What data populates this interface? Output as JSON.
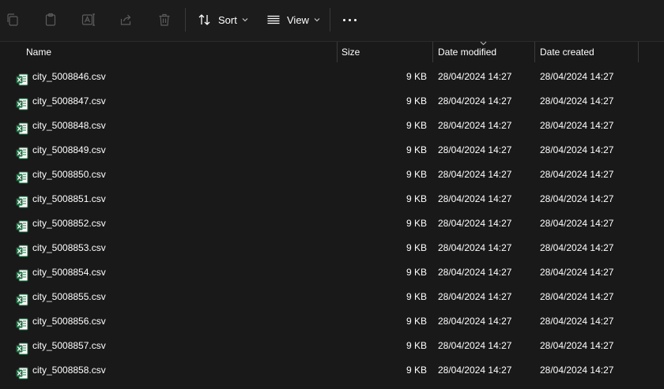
{
  "toolbar": {
    "sort_label": "Sort",
    "view_label": "View"
  },
  "columns": {
    "name": "Name",
    "size": "Size",
    "date_modified": "Date modified",
    "date_created": "Date created"
  },
  "files": [
    {
      "name": "city_5008846.csv",
      "size": "9 KB",
      "modified": "28/04/2024 14:27",
      "created": "28/04/2024 14:27"
    },
    {
      "name": "city_5008847.csv",
      "size": "9 KB",
      "modified": "28/04/2024 14:27",
      "created": "28/04/2024 14:27"
    },
    {
      "name": "city_5008848.csv",
      "size": "9 KB",
      "modified": "28/04/2024 14:27",
      "created": "28/04/2024 14:27"
    },
    {
      "name": "city_5008849.csv",
      "size": "9 KB",
      "modified": "28/04/2024 14:27",
      "created": "28/04/2024 14:27"
    },
    {
      "name": "city_5008850.csv",
      "size": "9 KB",
      "modified": "28/04/2024 14:27",
      "created": "28/04/2024 14:27"
    },
    {
      "name": "city_5008851.csv",
      "size": "9 KB",
      "modified": "28/04/2024 14:27",
      "created": "28/04/2024 14:27"
    },
    {
      "name": "city_5008852.csv",
      "size": "9 KB",
      "modified": "28/04/2024 14:27",
      "created": "28/04/2024 14:27"
    },
    {
      "name": "city_5008853.csv",
      "size": "9 KB",
      "modified": "28/04/2024 14:27",
      "created": "28/04/2024 14:27"
    },
    {
      "name": "city_5008854.csv",
      "size": "9 KB",
      "modified": "28/04/2024 14:27",
      "created": "28/04/2024 14:27"
    },
    {
      "name": "city_5008855.csv",
      "size": "9 KB",
      "modified": "28/04/2024 14:27",
      "created": "28/04/2024 14:27"
    },
    {
      "name": "city_5008856.csv",
      "size": "9 KB",
      "modified": "28/04/2024 14:27",
      "created": "28/04/2024 14:27"
    },
    {
      "name": "city_5008857.csv",
      "size": "9 KB",
      "modified": "28/04/2024 14:27",
      "created": "28/04/2024 14:27"
    },
    {
      "name": "city_5008858.csv",
      "size": "9 KB",
      "modified": "28/04/2024 14:27",
      "created": "28/04/2024 14:27"
    }
  ],
  "colors": {
    "background": "#191919",
    "excel_green": "#1d6f42",
    "disabled_icon": "#5c5c5c"
  }
}
